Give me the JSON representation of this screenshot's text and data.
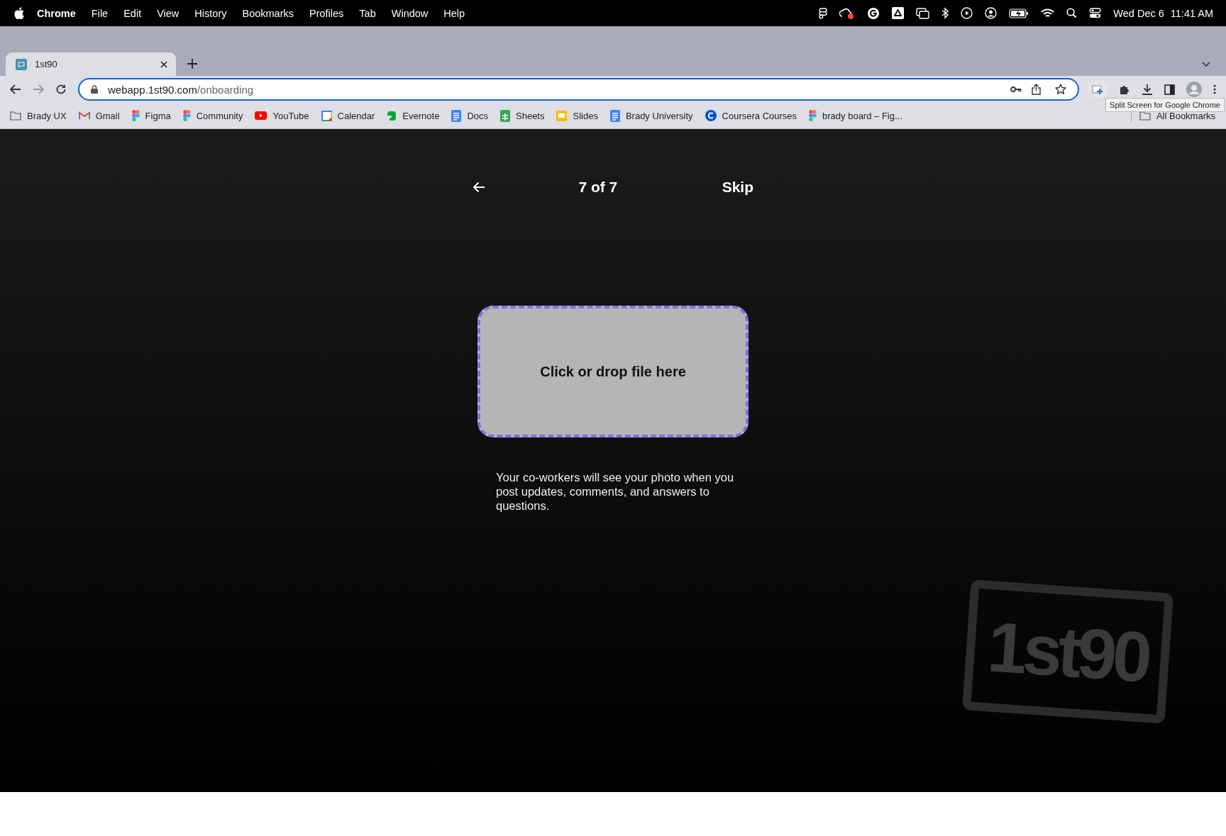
{
  "menu_bar": {
    "app": "Chrome",
    "items": [
      "File",
      "Edit",
      "View",
      "History",
      "Bookmarks",
      "Profiles",
      "Tab",
      "Window",
      "Help"
    ],
    "date": "Wed Dec 6",
    "time": "11:41 AM"
  },
  "tabs": [
    {
      "title": "1st90",
      "selected": true
    }
  ],
  "address_bar": {
    "host": "webapp.1st90.com",
    "path": "/onboarding"
  },
  "tooltip": "Split Screen for Google Chrome",
  "bookmarks": [
    {
      "label": "Brady UX",
      "kind": "folder"
    },
    {
      "label": "Gmail",
      "kind": "gmail"
    },
    {
      "label": "Figma",
      "kind": "figma"
    },
    {
      "label": "Community",
      "kind": "figma"
    },
    {
      "label": "YouTube",
      "kind": "youtube"
    },
    {
      "label": "Calendar",
      "kind": "calendar"
    },
    {
      "label": "Evernote",
      "kind": "evernote"
    },
    {
      "label": "Docs",
      "kind": "docs"
    },
    {
      "label": "Sheets",
      "kind": "sheets"
    },
    {
      "label": "Slides",
      "kind": "slides"
    },
    {
      "label": "Brady University",
      "kind": "docs"
    },
    {
      "label": "Coursera Courses",
      "kind": "coursera"
    },
    {
      "label": "brady board – Fig...",
      "kind": "figma"
    }
  ],
  "all_bookmarks": "All Bookmarks",
  "onboarding": {
    "step": "7 of 7",
    "skip": "Skip",
    "dropzone": "Click or drop file here",
    "description": "Your co-workers will see your photo when you post updates, comments, and answers to questions.",
    "logo_text": "1st90"
  }
}
